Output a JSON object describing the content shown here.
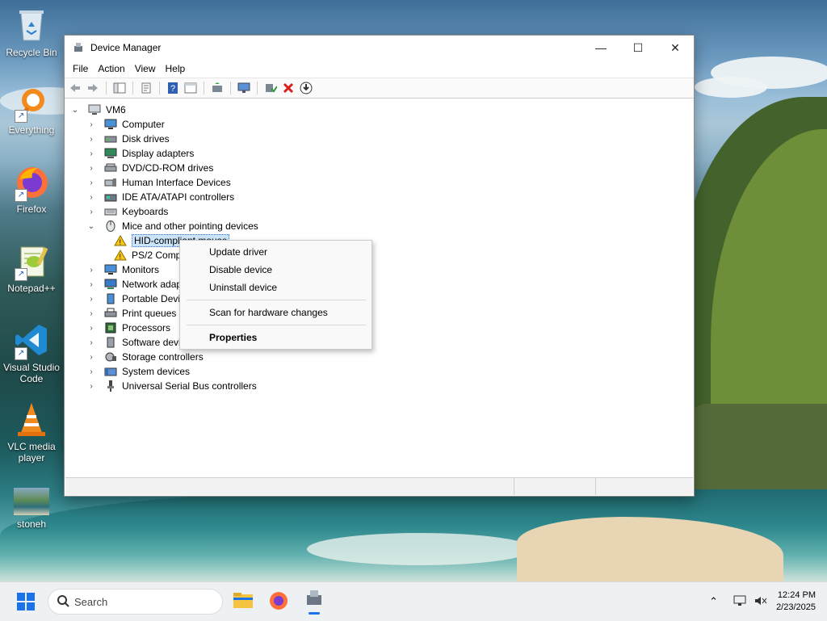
{
  "desktop": {
    "icons": [
      {
        "label": "Recycle Bin"
      },
      {
        "label": "Everything"
      },
      {
        "label": "Firefox"
      },
      {
        "label": "Notepad++"
      },
      {
        "label": "Visual Studio Code"
      },
      {
        "label": "VLC media player"
      },
      {
        "label": "stoneh"
      }
    ]
  },
  "window": {
    "title": "Device Manager",
    "menu": [
      "File",
      "Action",
      "View",
      "Help"
    ],
    "tree": {
      "root": "VM6",
      "categories": [
        "Computer",
        "Disk drives",
        "Display adapters",
        "DVD/CD-ROM drives",
        "Human Interface Devices",
        "IDE ATA/ATAPI controllers",
        "Keyboards",
        "Mice and other pointing devices",
        "Monitors",
        "Network adapt",
        "Portable Device",
        "Print queues",
        "Processors",
        "Software devic",
        "Storage controllers",
        "System devices",
        "Universal Serial Bus controllers"
      ],
      "mice_children": [
        "HID-compliant mouse",
        "PS/2 Comp"
      ]
    }
  },
  "context_menu": {
    "items": [
      "Update driver",
      "Disable device",
      "Uninstall device",
      "Scan for hardware changes",
      "Properties"
    ]
  },
  "taskbar": {
    "search_placeholder": "Search",
    "time": "12:24 PM",
    "date": "2/23/2025"
  },
  "colors": {
    "accent": "#2a6fd6",
    "error_red": "#d81e1e",
    "warning_yellow": "#f5c518"
  }
}
